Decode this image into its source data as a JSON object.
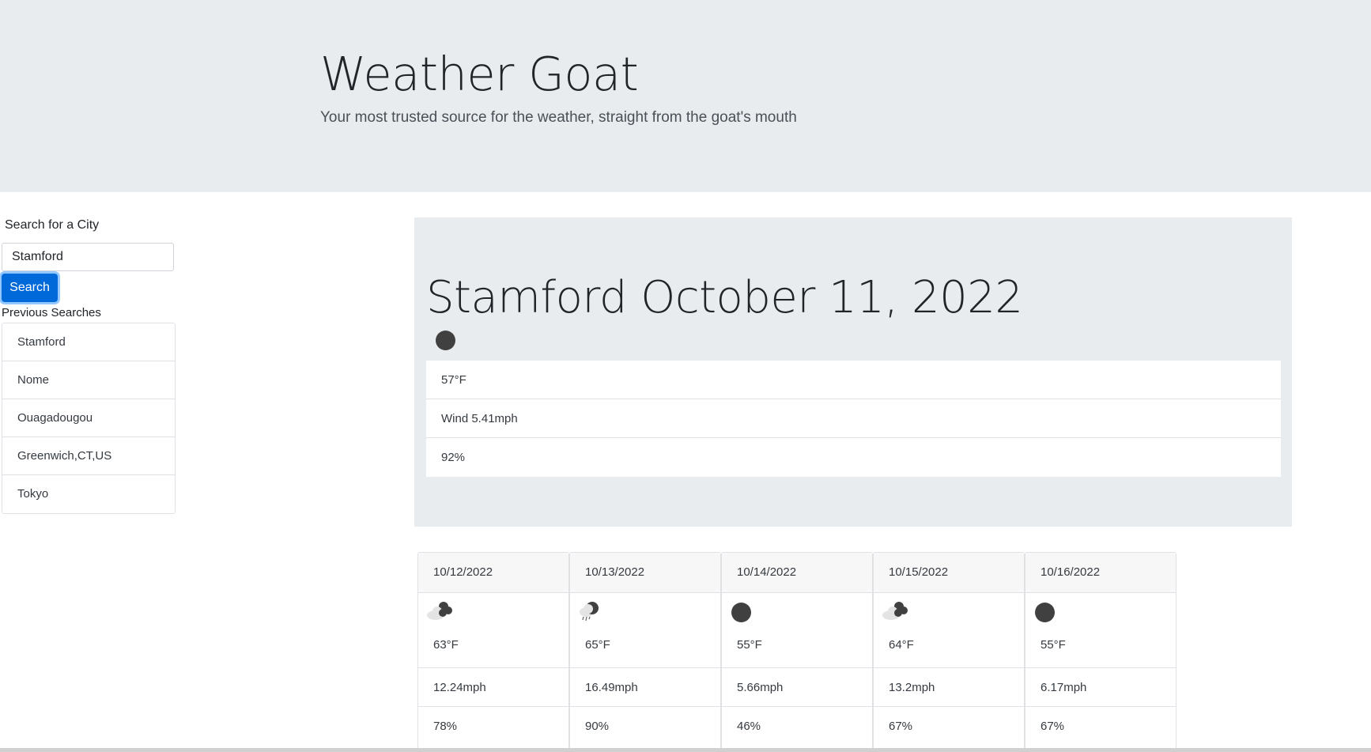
{
  "header": {
    "title": "Weather Goat",
    "subtitle": "Your most trusted source for the weather, straight from the goat's mouth"
  },
  "search": {
    "label": "Search for a City",
    "value": "Stamford",
    "button_label": "Search",
    "accent_color": "#0069d9"
  },
  "previous": {
    "label": "Previous Searches",
    "items": [
      "Stamford",
      "Nome",
      "Ouagadougou",
      "Greenwich,CT,US",
      "Tokyo"
    ]
  },
  "current": {
    "heading": "Stamford October 11, 2022",
    "icon": "clear-night-icon",
    "temp": "57°F",
    "wind": "Wind 5.41mph",
    "humidity": "92%"
  },
  "forecast": [
    {
      "date": "10/12/2022",
      "icon": "cloudy-night-icon",
      "temp": "63°F",
      "wind": "12.24mph",
      "humidity": "78%"
    },
    {
      "date": "10/13/2022",
      "icon": "rain-night-icon",
      "temp": "65°F",
      "wind": "16.49mph",
      "humidity": "90%"
    },
    {
      "date": "10/14/2022",
      "icon": "clear-night-icon",
      "temp": "55°F",
      "wind": "5.66mph",
      "humidity": "46%"
    },
    {
      "date": "10/15/2022",
      "icon": "cloudy-night-icon",
      "temp": "64°F",
      "wind": "13.2mph",
      "humidity": "67%"
    },
    {
      "date": "10/16/2022",
      "icon": "clear-night-icon",
      "temp": "55°F",
      "wind": "6.17mph",
      "humidity": "67%"
    }
  ]
}
